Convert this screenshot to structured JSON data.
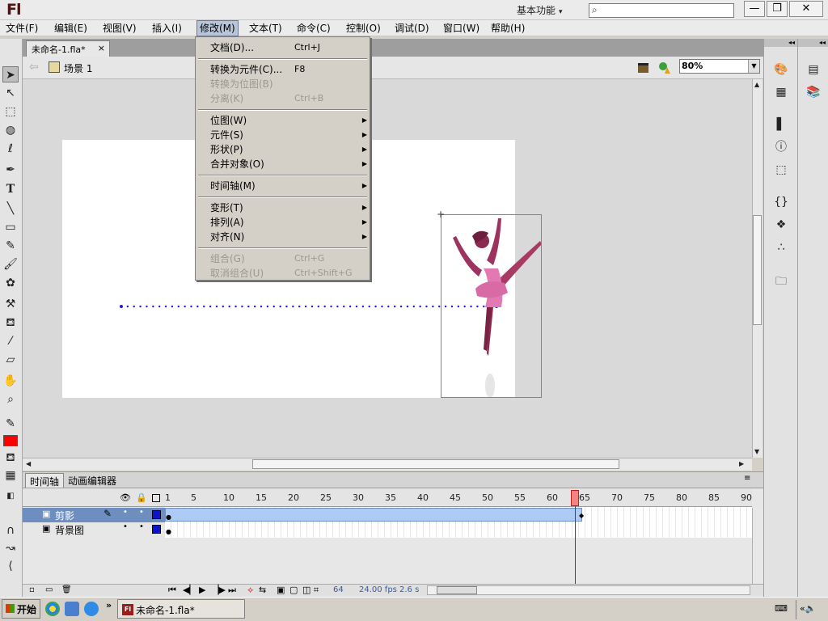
{
  "app": {
    "logo": "Fl"
  },
  "titlebar": {
    "workspace": "基本功能",
    "search_placeholder": ""
  },
  "menubar": {
    "items": [
      "文件(F)",
      "编辑(E)",
      "视图(V)",
      "插入(I)",
      "修改(M)",
      "文本(T)",
      "命令(C)",
      "控制(O)",
      "调试(D)",
      "窗口(W)",
      "帮助(H)"
    ],
    "active": "修改(M)"
  },
  "document": {
    "tab_label": "未命名-1.fla*",
    "close": "×"
  },
  "editbar": {
    "scene": "场景 1",
    "zoom": "80%"
  },
  "modify_menu": {
    "items": [
      {
        "label": "文档(D)...",
        "shortcut": "Ctrl+J",
        "enabled": true
      },
      {
        "separator": true
      },
      {
        "label": "转换为元件(C)...",
        "shortcut": "F8",
        "enabled": true
      },
      {
        "label": "转换为位图(B)",
        "shortcut": "",
        "enabled": false
      },
      {
        "label": "分离(K)",
        "shortcut": "Ctrl+B",
        "enabled": false
      },
      {
        "separator": true
      },
      {
        "label": "位图(W)",
        "submenu": true,
        "enabled": true
      },
      {
        "label": "元件(S)",
        "submenu": true,
        "enabled": true
      },
      {
        "label": "形状(P)",
        "submenu": true,
        "enabled": true
      },
      {
        "label": "合并对象(O)",
        "submenu": true,
        "enabled": true
      },
      {
        "separator": true
      },
      {
        "label": "时间轴(M)",
        "submenu": true,
        "enabled": true
      },
      {
        "separator": true
      },
      {
        "label": "变形(T)",
        "submenu": true,
        "enabled": true
      },
      {
        "label": "排列(A)",
        "submenu": true,
        "enabled": true
      },
      {
        "label": "对齐(N)",
        "submenu": true,
        "enabled": true
      },
      {
        "separator": true
      },
      {
        "label": "组合(G)",
        "shortcut": "Ctrl+G",
        "enabled": false
      },
      {
        "label": "取消组合(U)",
        "shortcut": "Ctrl+Shift+G",
        "enabled": false
      }
    ]
  },
  "timeline": {
    "tabs": [
      "时间轴",
      "动画编辑器"
    ],
    "frame_numbers": [
      "1",
      "5",
      "10",
      "15",
      "20",
      "25",
      "30",
      "35",
      "40",
      "45",
      "50",
      "55",
      "60",
      "65",
      "70",
      "75",
      "80",
      "85",
      "90"
    ],
    "layers": [
      {
        "name": "剪影",
        "selected": true,
        "color": "#0a14d0"
      },
      {
        "name": "背景图",
        "selected": false,
        "color": "#0a14d0"
      }
    ],
    "current_frame": "64",
    "fps": "24.00 fps",
    "time": "2.6 s"
  },
  "colors": {
    "stroke": "#ff0000",
    "tween": "#aecbf5",
    "playhead": "#d01010",
    "selection_box": "#29a0e6",
    "motion_path": "#1a1ae0"
  },
  "taskbar": {
    "start": "开始",
    "task_item": "未命名-1.fla*"
  }
}
